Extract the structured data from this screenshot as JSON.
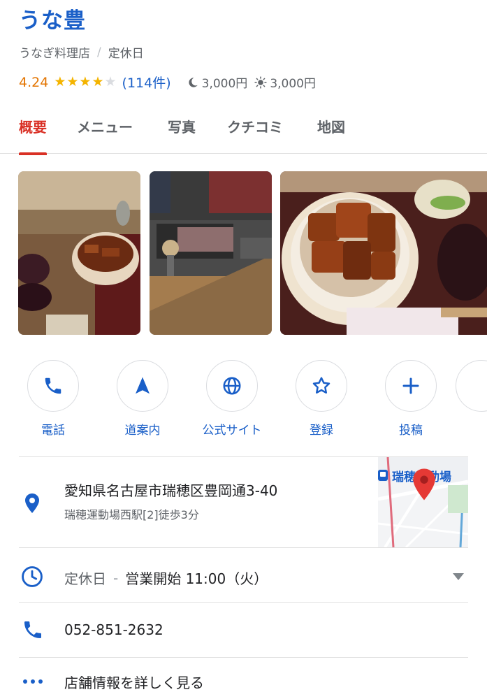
{
  "header": {
    "title": "うな豊",
    "category": "うなぎ料理店",
    "separator": "/",
    "status": "定休日"
  },
  "rating": {
    "score": "4.24",
    "stars": 4.24,
    "reviews": "(114件)",
    "dinner_price": "3,000円",
    "lunch_price": "3,000円"
  },
  "tabs": [
    {
      "label": "概要"
    },
    {
      "label": "メニュー"
    },
    {
      "label": "写真"
    },
    {
      "label": "クチコミ"
    },
    {
      "label": "地図"
    }
  ],
  "actions": [
    {
      "label": "電話",
      "icon": "phone-icon"
    },
    {
      "label": "道案内",
      "icon": "navigation-icon"
    },
    {
      "label": "公式サイト",
      "icon": "globe-icon"
    },
    {
      "label": "登録",
      "icon": "star-outline-icon"
    },
    {
      "label": "投稿",
      "icon": "plus-icon"
    }
  ],
  "address": {
    "line": "愛知県名古屋市瑞穂区豊岡通3-40",
    "station": "瑞穂運動場西駅[2]徒歩3分",
    "map_label": "瑞穂運動場"
  },
  "hours": {
    "status": "定休日",
    "dash": "-",
    "next_open": "営業開始 11:00（火）"
  },
  "phone": "052-851-2632",
  "more": "店舗情報を詳しく見る",
  "colors": {
    "brand_blue": "#1a5fc8",
    "active_tab": "#d93025",
    "star": "#f4b400",
    "score": "#e37400"
  }
}
